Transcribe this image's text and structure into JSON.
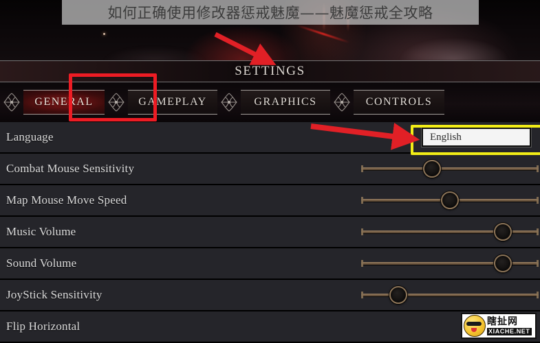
{
  "page": {
    "overlay_title": "如何正确使用修改器惩戒魅魔——魅魔惩戒全攻略"
  },
  "header": {
    "title": "SETTINGS"
  },
  "tabs": [
    {
      "label": "GENERAL",
      "active": true,
      "ornament": "fleur-ornament"
    },
    {
      "label": "GAMEPLAY",
      "active": false,
      "ornament": "fleur-ornament"
    },
    {
      "label": "GRAPHICS",
      "active": false,
      "ornament": "fleur-ornament"
    },
    {
      "label": "CONTROLS",
      "active": false,
      "ornament": "fleur-ornament"
    }
  ],
  "rows": [
    {
      "label": "Language",
      "control": "dropdown",
      "value": "English"
    },
    {
      "label": "Combat Mouse Sensitivity",
      "control": "slider",
      "percent": 40
    },
    {
      "label": "Map Mouse Move Speed",
      "control": "slider",
      "percent": 50
    },
    {
      "label": "Music Volume",
      "control": "slider",
      "percent": 80
    },
    {
      "label": "Sound Volume",
      "control": "slider",
      "percent": 80
    },
    {
      "label": "JoyStick Sensitivity",
      "control": "slider",
      "percent": 21
    },
    {
      "label": "Flip Horizontal",
      "control": "none",
      "value": ""
    }
  ],
  "annotations": {
    "red_box_target": "GENERAL",
    "yellow_box_target": "English",
    "arrow_to_settings": "arrow-icon",
    "arrow_to_language_value": "arrow-icon",
    "color_red": "#ED1C24",
    "color_yellow": "#F2ED17"
  },
  "watermark": {
    "cn": "瞎扯网",
    "en": "XIACHE.NET"
  }
}
